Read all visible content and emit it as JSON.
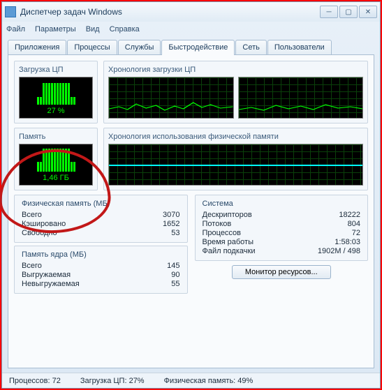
{
  "window": {
    "title": "Диспетчер задач Windows"
  },
  "menu": [
    "Файл",
    "Параметры",
    "Вид",
    "Справка"
  ],
  "tabs": [
    "Приложения",
    "Процессы",
    "Службы",
    "Быстродействие",
    "Сеть",
    "Пользователи"
  ],
  "active_tab": 3,
  "cpu": {
    "label": "Загрузка ЦП",
    "value": "27 %",
    "history_label": "Хронология загрузки ЦП"
  },
  "mem": {
    "label": "Память",
    "value": "1,46 ГБ",
    "history_label": "Хронология использования физической памяти"
  },
  "phys": {
    "title": "Физическая память (МБ)",
    "rows": [
      [
        "Всего",
        "3070"
      ],
      [
        "Кэшировано",
        "1652"
      ],
      [
        "Свободно",
        "53"
      ]
    ]
  },
  "kernel": {
    "title": "Память ядра (МБ)",
    "rows": [
      [
        "Всего",
        "145"
      ],
      [
        "Выгружаемая",
        "90"
      ],
      [
        "Невыгружаемая",
        "55"
      ]
    ]
  },
  "system": {
    "title": "Система",
    "rows": [
      [
        "Дескрипторов",
        "18222"
      ],
      [
        "Потоков",
        "804"
      ],
      [
        "Процессов",
        "72"
      ],
      [
        "Время работы",
        "1:58:03"
      ],
      [
        "Файл подкачки",
        "1902M / 498"
      ]
    ]
  },
  "resource_btn": "Монитор ресурсов...",
  "status": {
    "proc": "Процессов: 72",
    "cpu": "Загрузка ЦП: 27%",
    "mem": "Физическая память: 49%"
  }
}
